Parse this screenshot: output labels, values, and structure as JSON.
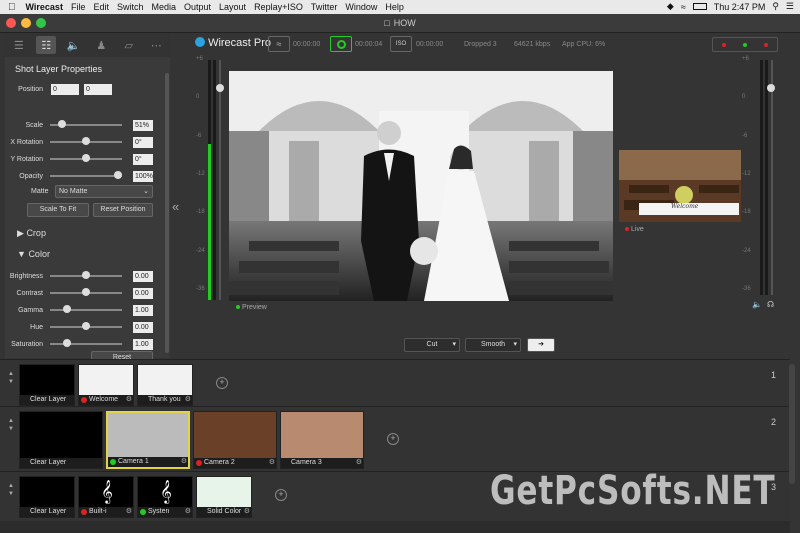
{
  "menubar": {
    "app": "Wirecast",
    "items": [
      "File",
      "Edit",
      "Switch",
      "Media",
      "Output",
      "Layout",
      "Replay+ISO",
      "Twitter",
      "Window",
      "Help"
    ],
    "clock": "Thu 2:47 PM"
  },
  "window": {
    "title": "HOW"
  },
  "toolbar_icons": [
    "layers-icon",
    "sliders-icon",
    "audio-icon",
    "person-icon",
    "transform-icon",
    "more-icon"
  ],
  "properties": {
    "title": "Shot Layer Properties",
    "position_label": "Position",
    "position_x": "0",
    "position_y": "0",
    "rows": [
      {
        "label": "Scale",
        "value": "51%",
        "level": 0.12
      },
      {
        "label": "X Rotation",
        "value": "0°",
        "level": 0.5
      },
      {
        "label": "Y Rotation",
        "value": "0°",
        "level": 0.5
      },
      {
        "label": "Opacity",
        "value": "100%",
        "level": 1.0
      }
    ],
    "matte_label": "Matte",
    "matte_value": "No Matte",
    "scale_to_fit": "Scale To Fit",
    "reset_position": "Reset Position",
    "crop": "Crop",
    "color": "Color",
    "color_rows": [
      {
        "label": "Brightness",
        "value": "0.00",
        "level": 0.5
      },
      {
        "label": "Contrast",
        "value": "0.00",
        "level": 0.5
      },
      {
        "label": "Gamma",
        "value": "1.00",
        "level": 0.2
      },
      {
        "label": "Hue",
        "value": "0.00",
        "level": 0.5
      },
      {
        "label": "Saturation",
        "value": "1.00",
        "level": 0.2
      }
    ],
    "reset": "Reset"
  },
  "topbar": {
    "logo": "Wirecast Pro",
    "stream_time": "00:00:00",
    "record_time": "00:00:04",
    "iso_label": "ISO",
    "iso_time": "00:00:00",
    "dropped": "Dropped 3",
    "kbps": "64621 kbps",
    "cpu": "App CPU:  6%"
  },
  "preview_label": "Preview",
  "live_label": "Live",
  "live_overlay_title": "Welcome",
  "meter_ticks": [
    "+6",
    "0",
    "-6",
    "-12",
    "-18",
    "-24",
    "-36"
  ],
  "transition": {
    "cut": "Cut",
    "smooth": "Smooth"
  },
  "layers": [
    {
      "num": "1",
      "shots": [
        {
          "name": "Clear Layer",
          "dot": ""
        },
        {
          "name": "Welcome",
          "dot": "#d22"
        },
        {
          "name": "Thank you",
          "dot": ""
        }
      ]
    },
    {
      "num": "2",
      "shots": [
        {
          "name": "Clear Layer",
          "dot": ""
        },
        {
          "name": "Camera 1",
          "dot": "#2c2"
        },
        {
          "name": "Camera 2",
          "dot": "#d22"
        },
        {
          "name": "Camera 3",
          "dot": ""
        }
      ]
    },
    {
      "num": "3",
      "shots": [
        {
          "name": "Clear Layer",
          "dot": ""
        },
        {
          "name": "Built-i",
          "dot": "#d22"
        },
        {
          "name": "Systen",
          "dot": "#2c2"
        },
        {
          "name": "Solid Color",
          "dot": ""
        }
      ]
    }
  ],
  "watermark": "GetPcSofts.NET",
  "colors": {
    "live_red": "#d22",
    "preview_green": "#2c2",
    "selected_border": "#e3d34a"
  }
}
